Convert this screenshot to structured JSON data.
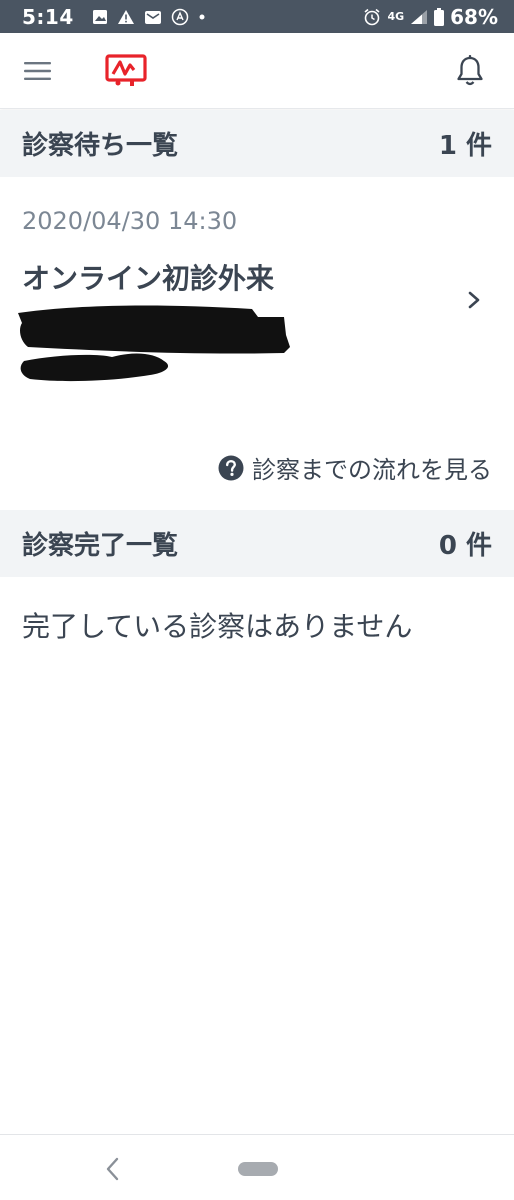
{
  "status_bar": {
    "time": "5:14",
    "network": "4G",
    "battery": "68%"
  },
  "header": {
    "menu_icon": "hamburger-menu-icon",
    "logo_icon": "app-logo-icon",
    "notification_icon": "bell-icon",
    "brand_color": "#e8232a"
  },
  "waiting_section": {
    "title": "診察待ち一覧",
    "count": "1 件"
  },
  "appointment": {
    "datetime": "2020/04/30 14:30",
    "type": "オンライン初診外来"
  },
  "flow_link": {
    "label": "診察までの流れを見る",
    "icon": "help-circle-icon"
  },
  "completed_section": {
    "title": "診察完了一覧",
    "count": "0 件",
    "empty_message": "完了している診察はありません"
  },
  "colors": {
    "status_bar": "#4a5562",
    "text": "#3b4552",
    "muted_text": "#7c8794",
    "section_bg": "#f2f4f6"
  }
}
